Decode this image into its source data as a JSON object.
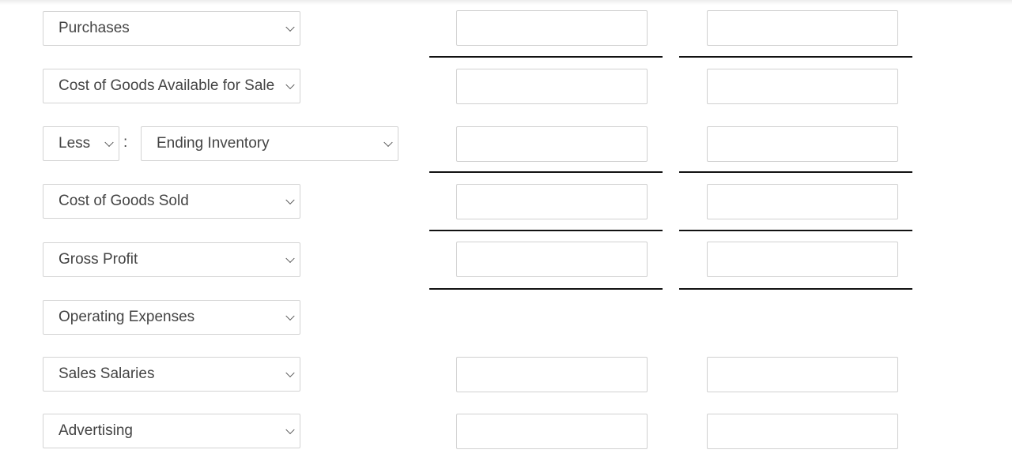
{
  "rows": [
    {
      "label": "Purchases"
    },
    {
      "label": "Cost of Goods Available for Sale"
    },
    {
      "prefix": "Less",
      "separator": ":",
      "label": "Ending Inventory"
    },
    {
      "label": "Cost of Goods Sold"
    },
    {
      "label": "Gross Profit"
    },
    {
      "label": "Operating Expenses"
    },
    {
      "label": "Sales Salaries"
    },
    {
      "label": "Advertising"
    }
  ],
  "inputs": {
    "col1_values": [
      "",
      "",
      "",
      "",
      "",
      "",
      "",
      ""
    ],
    "col2_values": [
      "",
      "",
      "",
      "",
      "",
      "",
      "",
      ""
    ]
  }
}
